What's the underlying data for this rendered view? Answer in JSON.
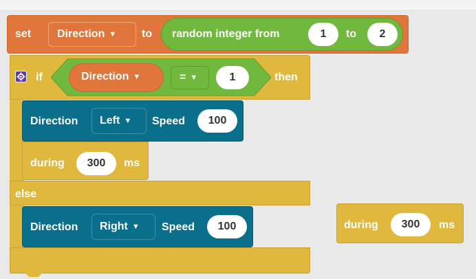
{
  "colors": {
    "orange": "#e0763c",
    "green": "#71b83e",
    "yellow": "#e0b83e",
    "teal": "#0a6f8a",
    "purple": "#5b3bb0",
    "background": "#e9e9e9"
  },
  "set_block": {
    "set_label": "set",
    "variable": "Direction",
    "to_label": "to",
    "random_label": "random integer from",
    "from_value": "1",
    "to_label2": "to",
    "to_value": "2"
  },
  "if_block": {
    "if_label": "if",
    "gear_icon": "gear-icon",
    "variable": "Direction",
    "operator": "=",
    "value": "1",
    "then_label": "then",
    "else_label": "else"
  },
  "motor_left": {
    "direction_label": "Direction",
    "direction_value": "Left",
    "speed_label": "Speed",
    "speed_value": "100"
  },
  "during_inner": {
    "during_label": "during",
    "value": "300",
    "unit": "ms"
  },
  "motor_right": {
    "direction_label": "Direction",
    "direction_value": "Right",
    "speed_label": "Speed",
    "speed_value": "100"
  },
  "during_floating": {
    "during_label": "during",
    "value": "300",
    "unit": "ms"
  },
  "dropdown_caret": "▼"
}
